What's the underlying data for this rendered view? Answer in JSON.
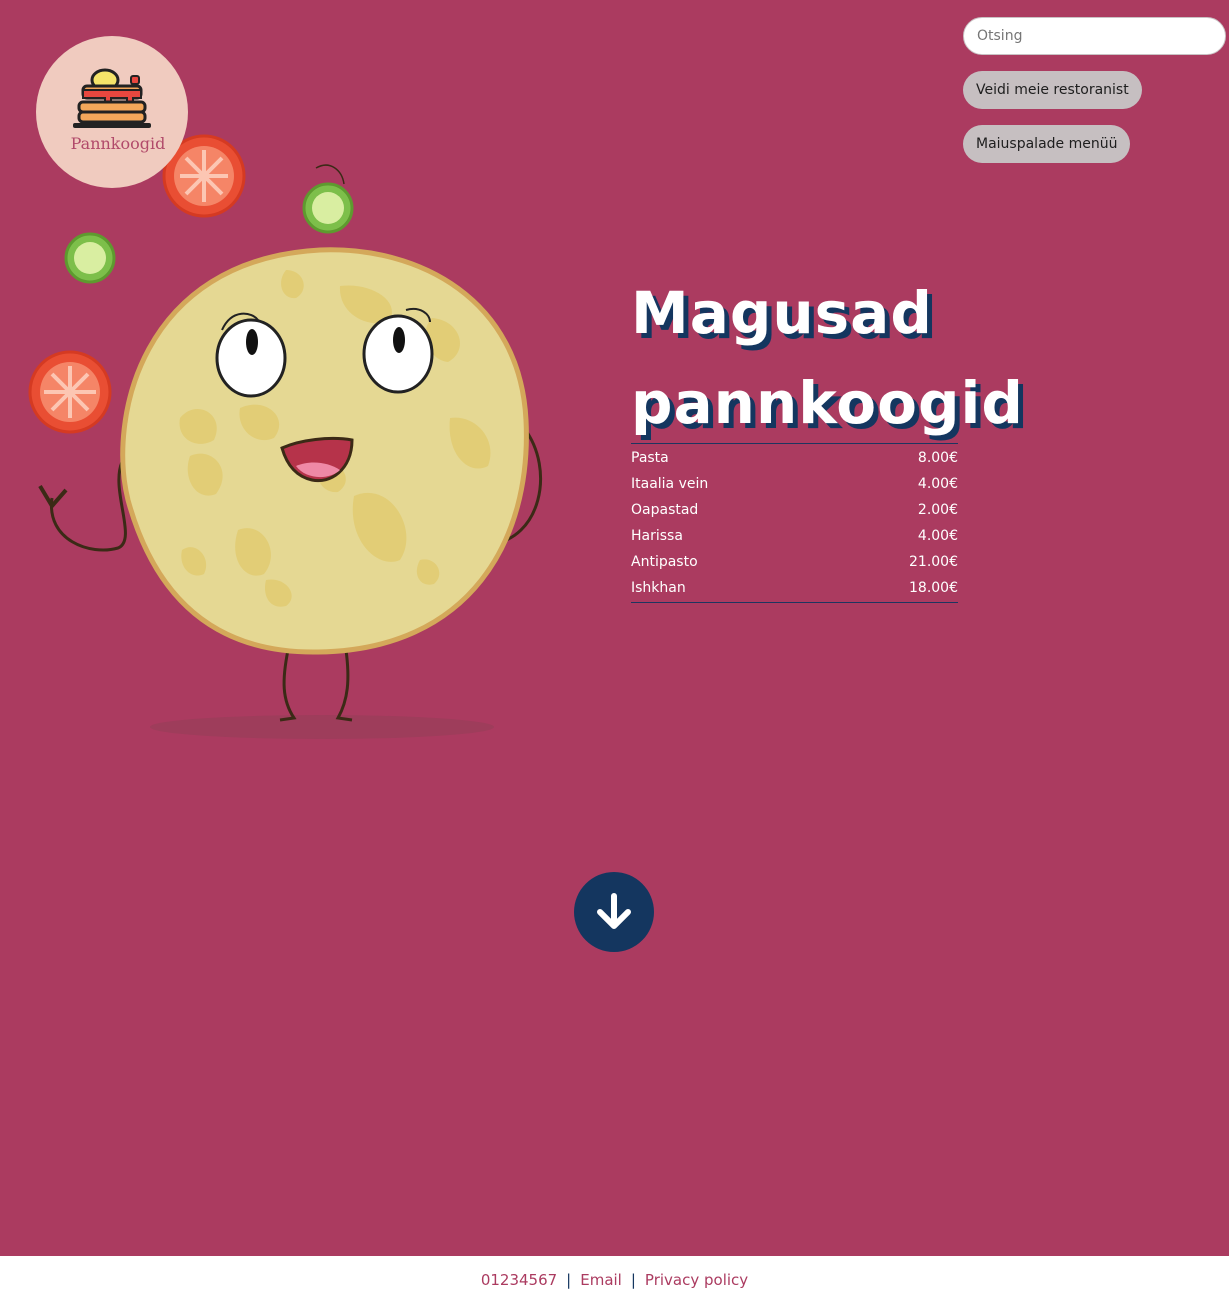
{
  "colors": {
    "background": "#ab3b60",
    "accent_dark": "#14365f",
    "logo_bg": "#f0cbbf",
    "pill_bg": "#c6bfc1"
  },
  "logo": {
    "text": "Pannkoogid",
    "icon": "pancake-stack-icon"
  },
  "search": {
    "placeholder": "Otsing",
    "value": ""
  },
  "nav": {
    "about_label": "Veidi meie restoranist",
    "menu_label": "Maiuspalade menüü"
  },
  "hero": {
    "title": "Magusad pannkoogid"
  },
  "menu": {
    "items": [
      {
        "name": "Pasta",
        "price": "8.00€"
      },
      {
        "name": "Itaalia vein",
        "price": "4.00€"
      },
      {
        "name": "Oapastad",
        "price": "2.00€"
      },
      {
        "name": "Harissa",
        "price": "4.00€"
      },
      {
        "name": "Antipasto",
        "price": "21.00€"
      },
      {
        "name": "Ishkhan",
        "price": "18.00€"
      }
    ]
  },
  "scroll": {
    "icon": "arrow-down-icon"
  },
  "footer": {
    "phone": "01234567",
    "email_label": "Email",
    "privacy_label": "Privacy policy",
    "separator": "|"
  }
}
